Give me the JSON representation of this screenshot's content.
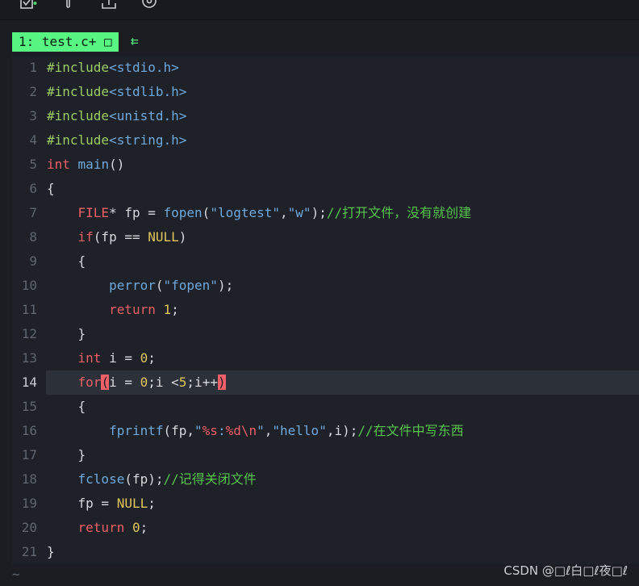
{
  "colors": {
    "background": "#1b1d22",
    "editor_bg": "#1e2127",
    "tab_green": "#58f582",
    "keyword_red": "#ef5f67",
    "comment_green": "#57c44e",
    "string_blue": "#6fa8dc",
    "number_yellow": "#e0c65b",
    "preproc_green": "#9ccc65",
    "current_line_bg": "#2c3038"
  },
  "toolbar": {
    "icons": [
      "checklist-icon",
      "pin-icon",
      "upload-icon",
      "target-icon"
    ]
  },
  "tab": {
    "label": "1: test.c+ □",
    "arrow": "⇇"
  },
  "editor": {
    "current_line": 14,
    "lines": [
      {
        "num": "1",
        "segs": [
          {
            "t": "#include",
            "c": "pp"
          },
          {
            "t": "<stdio.h>",
            "c": "str"
          }
        ]
      },
      {
        "num": "2",
        "segs": [
          {
            "t": "#include",
            "c": "pp"
          },
          {
            "t": "<stdlib.h>",
            "c": "str"
          }
        ]
      },
      {
        "num": "3",
        "segs": [
          {
            "t": "#include",
            "c": "pp"
          },
          {
            "t": "<unistd.h>",
            "c": "str"
          }
        ]
      },
      {
        "num": "4",
        "segs": [
          {
            "t": "#include",
            "c": "pp"
          },
          {
            "t": "<string.h>",
            "c": "str"
          }
        ]
      },
      {
        "num": "5",
        "segs": [
          {
            "t": "int",
            "c": "kw"
          },
          {
            "t": " ",
            "c": "p"
          },
          {
            "t": "main",
            "c": "fn"
          },
          {
            "t": "()",
            "c": "p"
          }
        ]
      },
      {
        "num": "6",
        "segs": [
          {
            "t": "{",
            "c": "p"
          }
        ]
      },
      {
        "num": "7",
        "segs": [
          {
            "t": "    ",
            "c": "p"
          },
          {
            "t": "FILE",
            "c": "kw"
          },
          {
            "t": "* fp = ",
            "c": "p"
          },
          {
            "t": "fopen",
            "c": "fn"
          },
          {
            "t": "(",
            "c": "p"
          },
          {
            "t": "\"logtest\"",
            "c": "str"
          },
          {
            "t": ",",
            "c": "p"
          },
          {
            "t": "\"w\"",
            "c": "str"
          },
          {
            "t": ");",
            "c": "p"
          },
          {
            "t": "//打开文件，没有就创建",
            "c": "cm"
          }
        ]
      },
      {
        "num": "8",
        "segs": [
          {
            "t": "    ",
            "c": "p"
          },
          {
            "t": "if",
            "c": "kw"
          },
          {
            "t": "(fp == ",
            "c": "p"
          },
          {
            "t": "NULL",
            "c": "num"
          },
          {
            "t": ")",
            "c": "p"
          }
        ]
      },
      {
        "num": "9",
        "segs": [
          {
            "t": "    {",
            "c": "p"
          }
        ]
      },
      {
        "num": "10",
        "segs": [
          {
            "t": "        ",
            "c": "p"
          },
          {
            "t": "perror",
            "c": "fn"
          },
          {
            "t": "(",
            "c": "p"
          },
          {
            "t": "\"fopen\"",
            "c": "str"
          },
          {
            "t": ");",
            "c": "p"
          }
        ]
      },
      {
        "num": "11",
        "segs": [
          {
            "t": "        ",
            "c": "p"
          },
          {
            "t": "return",
            "c": "kw"
          },
          {
            "t": " ",
            "c": "p"
          },
          {
            "t": "1",
            "c": "num"
          },
          {
            "t": ";",
            "c": "p"
          }
        ]
      },
      {
        "num": "12",
        "segs": [
          {
            "t": "    }",
            "c": "p"
          }
        ]
      },
      {
        "num": "13",
        "segs": [
          {
            "t": "    ",
            "c": "p"
          },
          {
            "t": "int",
            "c": "kw"
          },
          {
            "t": " i = ",
            "c": "p"
          },
          {
            "t": "0",
            "c": "num"
          },
          {
            "t": ";",
            "c": "p"
          }
        ]
      },
      {
        "num": "14",
        "segs": [
          {
            "t": "    ",
            "c": "p"
          },
          {
            "t": "for",
            "c": "kw"
          },
          {
            "t": "(",
            "c": "hl"
          },
          {
            "t": "i = ",
            "c": "p"
          },
          {
            "t": "0",
            "c": "num"
          },
          {
            "t": ";i <",
            "c": "p"
          },
          {
            "t": "5",
            "c": "num"
          },
          {
            "t": ";i++",
            "c": "p"
          },
          {
            "t": ")",
            "c": "hl"
          }
        ]
      },
      {
        "num": "15",
        "segs": [
          {
            "t": "    {",
            "c": "p"
          }
        ]
      },
      {
        "num": "16",
        "segs": [
          {
            "t": "        ",
            "c": "p"
          },
          {
            "t": "fprintf",
            "c": "fn"
          },
          {
            "t": "(fp,",
            "c": "p"
          },
          {
            "t": "\"",
            "c": "str"
          },
          {
            "t": "%s",
            "c": "kw"
          },
          {
            "t": ":",
            "c": "str"
          },
          {
            "t": "%d",
            "c": "kw"
          },
          {
            "t": "\\n",
            "c": "kw"
          },
          {
            "t": "\"",
            "c": "str"
          },
          {
            "t": ",",
            "c": "p"
          },
          {
            "t": "\"hello\"",
            "c": "str"
          },
          {
            "t": ",i);",
            "c": "p"
          },
          {
            "t": "//在文件中写东西",
            "c": "cm"
          }
        ]
      },
      {
        "num": "17",
        "segs": [
          {
            "t": "    }",
            "c": "p"
          }
        ]
      },
      {
        "num": "18",
        "segs": [
          {
            "t": "    ",
            "c": "p"
          },
          {
            "t": "fclose",
            "c": "fn"
          },
          {
            "t": "(fp);",
            "c": "p"
          },
          {
            "t": "//记得关闭文件",
            "c": "cm"
          }
        ]
      },
      {
        "num": "19",
        "segs": [
          {
            "t": "    fp = ",
            "c": "p"
          },
          {
            "t": "NULL",
            "c": "num"
          },
          {
            "t": ";",
            "c": "p"
          }
        ]
      },
      {
        "num": "20",
        "segs": [
          {
            "t": "    ",
            "c": "p"
          },
          {
            "t": "return",
            "c": "kw"
          },
          {
            "t": " ",
            "c": "p"
          },
          {
            "t": "0",
            "c": "num"
          },
          {
            "t": ";",
            "c": "p"
          }
        ]
      },
      {
        "num": "21",
        "segs": [
          {
            "t": "}",
            "c": "p"
          }
        ]
      }
    ],
    "tilde": "~"
  },
  "watermark": "CSDN @□ℓ白□ℓ夜□ℓ"
}
